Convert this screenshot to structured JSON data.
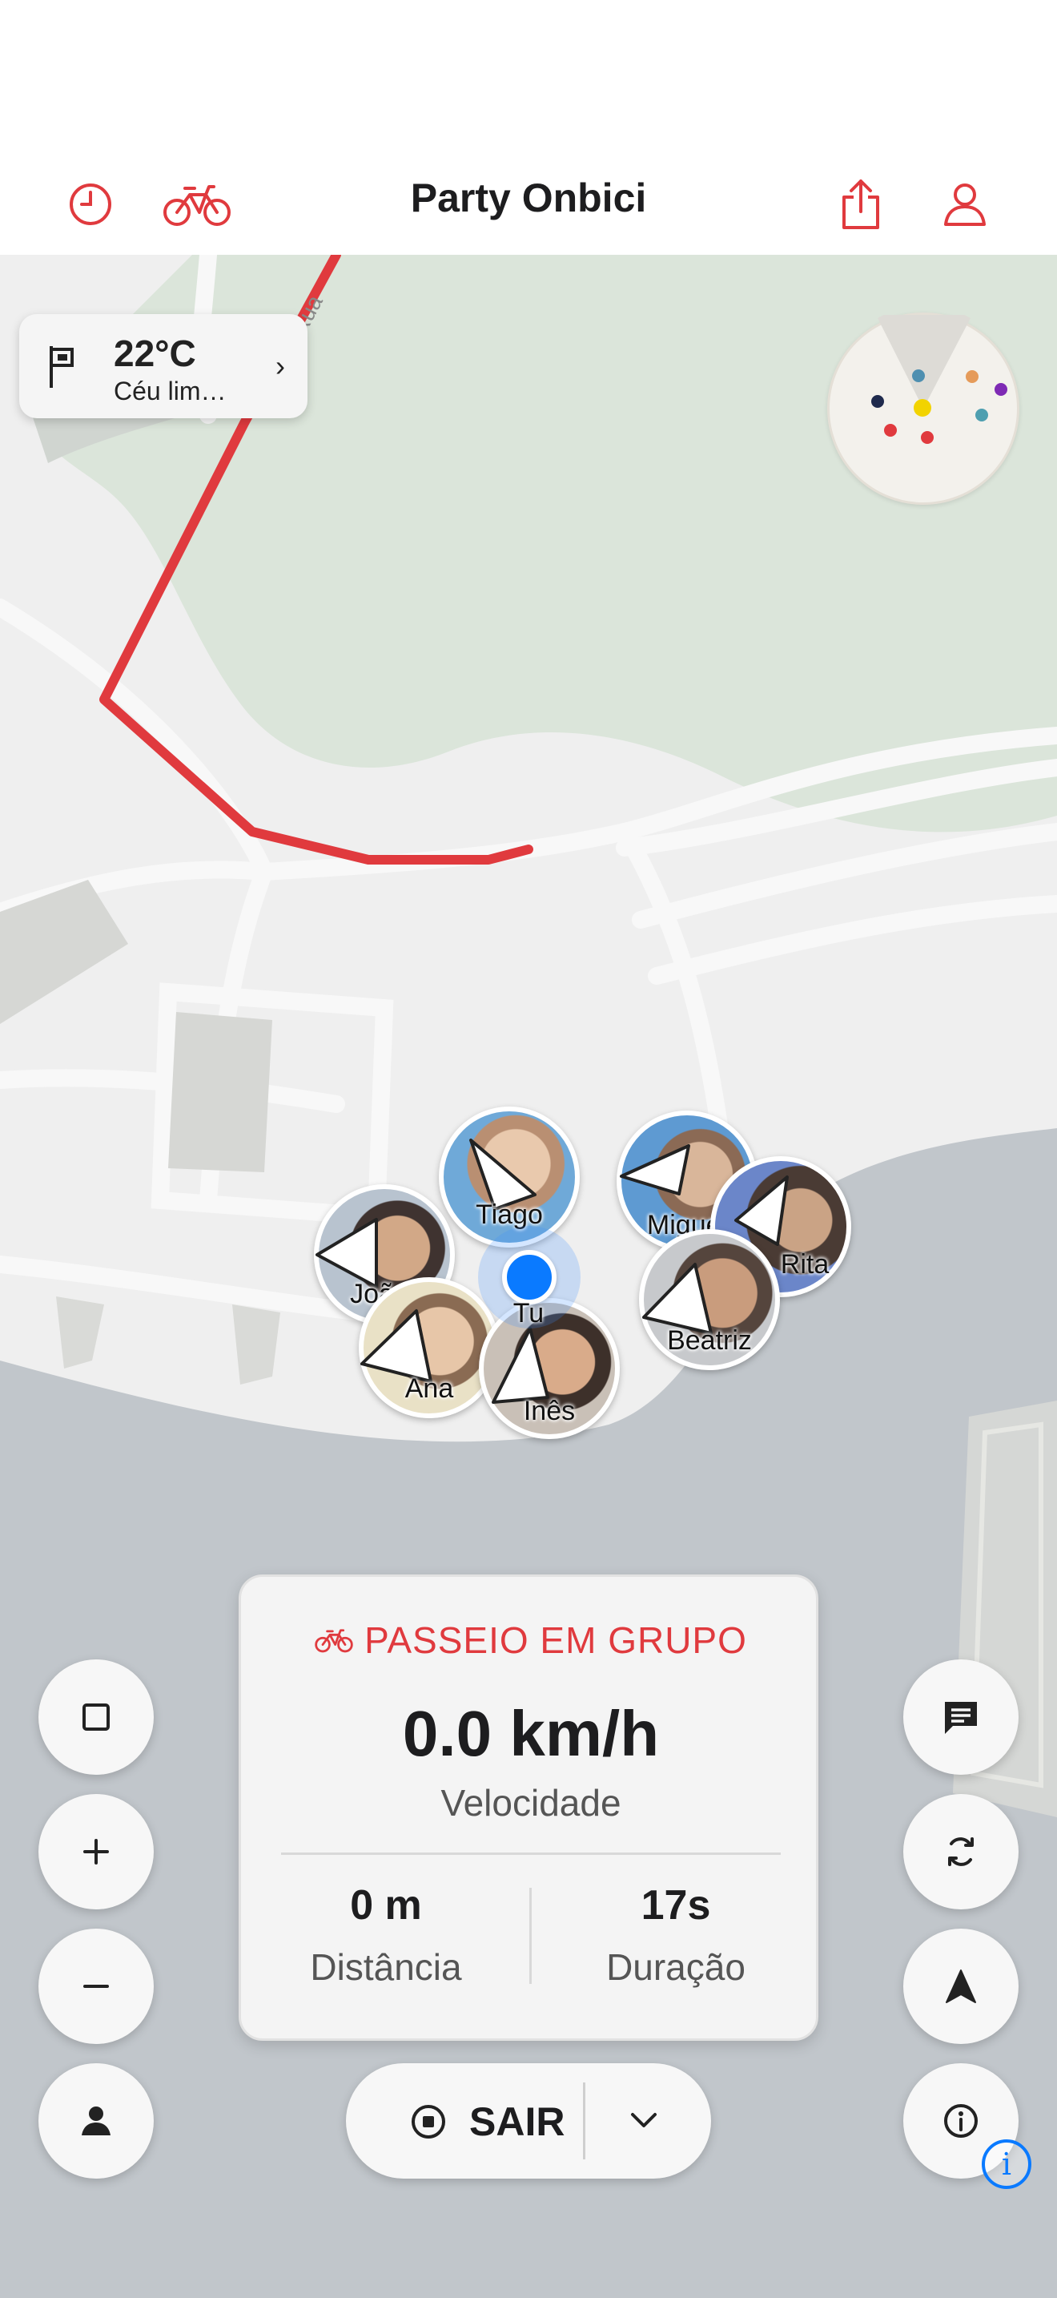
{
  "header": {
    "title": "Party Onbici",
    "left_icons": [
      "history-icon",
      "bike-icon"
    ],
    "right_icons": [
      "share-icon",
      "profile-icon"
    ]
  },
  "map": {
    "road_label": "Rua",
    "route_color": "#e03a3e"
  },
  "weather": {
    "temperature": "22°C",
    "condition": "Céu lim…",
    "icon": "flag-icon"
  },
  "radar": {
    "dot_colors": [
      "#1f2a4d",
      "#4e8fb0",
      "#e59b5a",
      "#7e2ab4",
      "#f2d300",
      "#4e9fb0",
      "#e03a3e",
      "#e03a3e"
    ]
  },
  "riders": [
    {
      "name": "Tiago"
    },
    {
      "name": "Miguel"
    },
    {
      "name": "Rita"
    },
    {
      "name": "João"
    },
    {
      "name": "Beatriz"
    },
    {
      "name": "Ana"
    },
    {
      "name": "Inês"
    }
  ],
  "me": {
    "label": "Tu",
    "color": "#0a7aff"
  },
  "stats": {
    "mode_label": "PASSEIO EM GRUPO",
    "speed": "0.0 km/h",
    "speed_label": "Velocidade",
    "distance": "0 m",
    "distance_label": "Distância",
    "duration": "17s",
    "duration_label": "Duração"
  },
  "left_controls": [
    "square-icon",
    "zoom-in-icon",
    "zoom-out-icon",
    "person-icon"
  ],
  "right_controls": [
    "chat-icon",
    "refresh-icon",
    "navigate-icon",
    "info-icon"
  ],
  "exit": {
    "label": "SAIR"
  },
  "attribution": {
    "label": "i"
  }
}
